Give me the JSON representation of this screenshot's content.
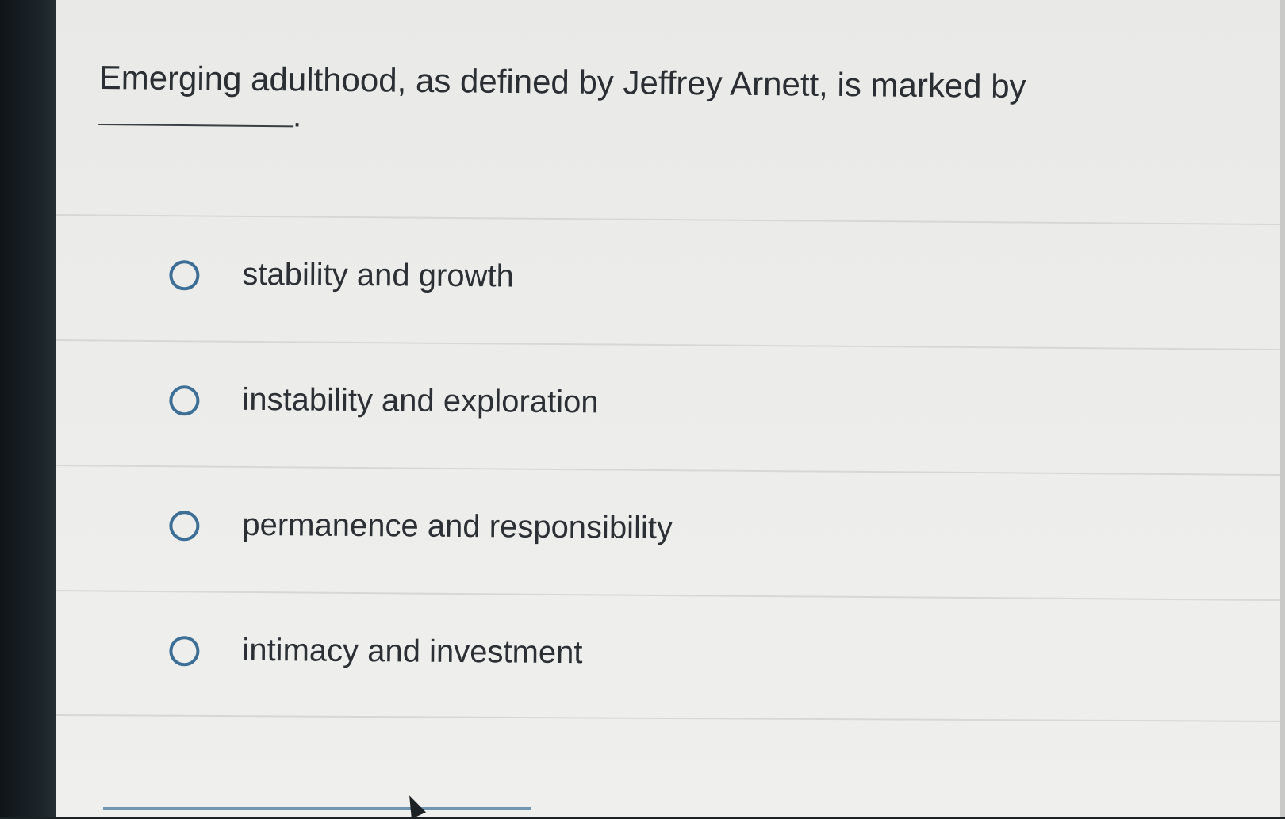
{
  "question": {
    "text": "Emerging adulthood, as defined by Jeffrey Arnett, is marked by"
  },
  "options": [
    {
      "label": "stability and growth",
      "selected": false
    },
    {
      "label": "instability and exploration",
      "selected": false
    },
    {
      "label": "permanence and responsibility",
      "selected": false
    },
    {
      "label": "intimacy and investment",
      "selected": false
    }
  ],
  "colors": {
    "radio_border": "#3d6f96",
    "text": "#2b2f33",
    "background": "#ececea"
  }
}
